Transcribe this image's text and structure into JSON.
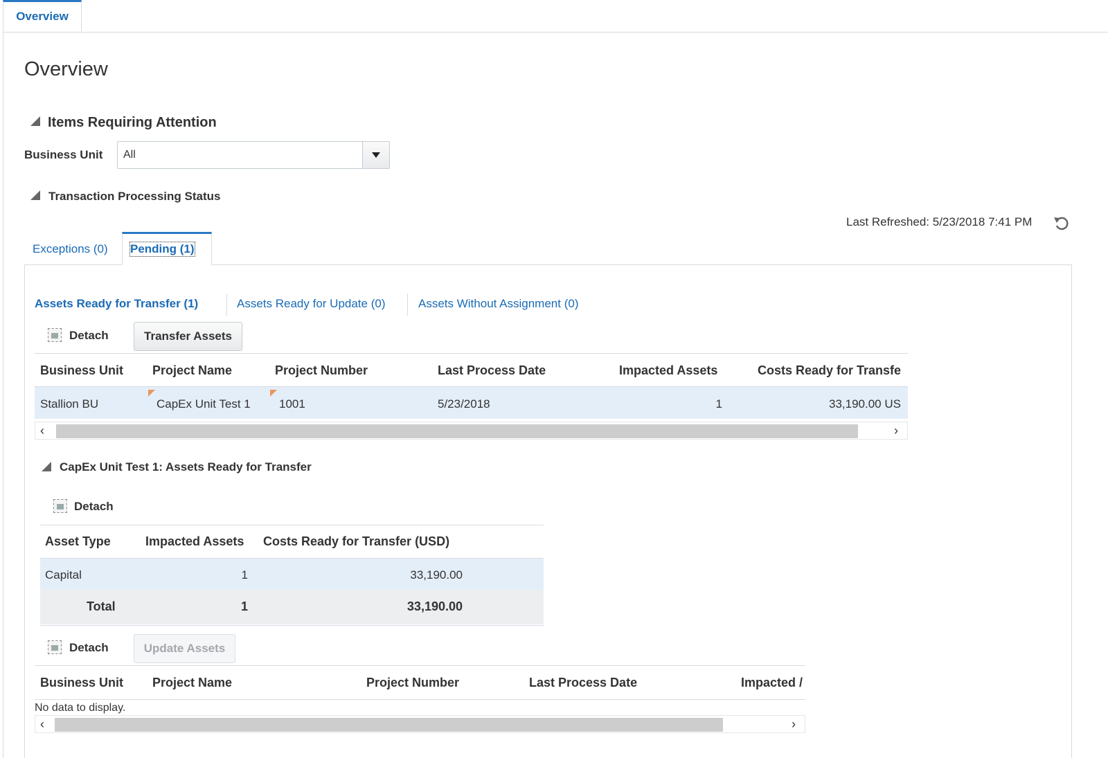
{
  "top_tab": {
    "label": "Overview"
  },
  "page_title": "Overview",
  "items_section": {
    "title": "Items Requiring Attention"
  },
  "business_unit_filter": {
    "label": "Business Unit",
    "value": "All"
  },
  "tps_section": {
    "title": "Transaction Processing Status"
  },
  "last_refreshed": "Last Refreshed: 5/23/2018 7:41 PM",
  "status_tabs": [
    {
      "label": "Exceptions (0)"
    },
    {
      "label": "Pending (1)"
    }
  ],
  "sub_links": [
    {
      "label": "Assets Ready for Transfer (1)"
    },
    {
      "label": "Assets Ready for Update (0)"
    },
    {
      "label": "Assets Without Assignment (0)"
    }
  ],
  "toolbar1": {
    "detach": "Detach",
    "action": "Transfer Assets"
  },
  "table1": {
    "headers": [
      "Business Unit",
      "Project Name",
      "Project Number",
      "Last Process Date",
      "Impacted Assets",
      "Costs Ready for Transfe"
    ],
    "rows": [
      [
        "Stallion BU",
        "CapEx Unit Test 1",
        "1001",
        "5/23/2018",
        "1",
        "33,190.00 US"
      ]
    ]
  },
  "detail_section": {
    "title": "CapEx Unit Test 1: Assets Ready for Transfer"
  },
  "toolbar2": {
    "detach": "Detach"
  },
  "table2": {
    "headers": [
      "Asset Type",
      "Impacted Assets",
      "Costs Ready for Transfer (USD)"
    ],
    "rows": [
      [
        "Capital",
        "1",
        "33,190.00"
      ]
    ],
    "total": [
      "Total",
      "1",
      "33,190.00"
    ]
  },
  "toolbar3": {
    "detach": "Detach",
    "action": "Update Assets"
  },
  "table3": {
    "headers": [
      "Business Unit",
      "Project Name",
      "Project Number",
      "Last Process Date",
      "Impacted /"
    ],
    "empty_text": "No data to display."
  },
  "colors": {
    "accent": "#2a78c4",
    "link": "#1a6bb5",
    "row_highlight": "#e4eef9"
  }
}
